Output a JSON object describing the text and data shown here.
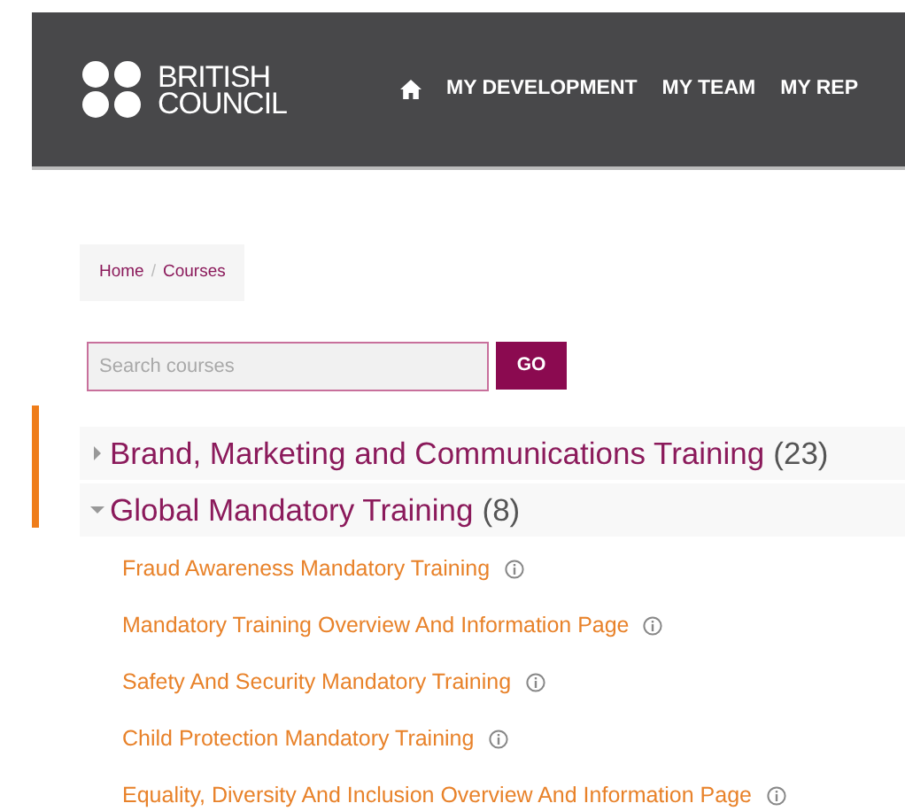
{
  "header": {
    "logo": {
      "line_1": "BRITISH",
      "line_2": "COUNCIL"
    },
    "nav": [
      "MY DEVELOPMENT",
      "MY TEAM",
      "MY REP"
    ]
  },
  "breadcrumb": {
    "separator": "/",
    "items": [
      "Home",
      "Courses"
    ]
  },
  "search": {
    "placeholder": "Search courses",
    "button": "GO"
  },
  "categories": [
    {
      "name": "Brand, Marketing and Communications Training",
      "count": "(23)",
      "expanded": false
    },
    {
      "name": "Global Mandatory Training",
      "count": "(8)",
      "expanded": true,
      "children": [
        {
          "name": "Fraud Awareness Mandatory Training"
        },
        {
          "name": "Mandatory Training Overview And Information Page"
        },
        {
          "name": "Safety And Security Mandatory Training"
        },
        {
          "name": "Child Protection Mandatory Training"
        },
        {
          "name": "Equality, Diversity And Inclusion Overview And Information Page"
        }
      ]
    }
  ]
}
